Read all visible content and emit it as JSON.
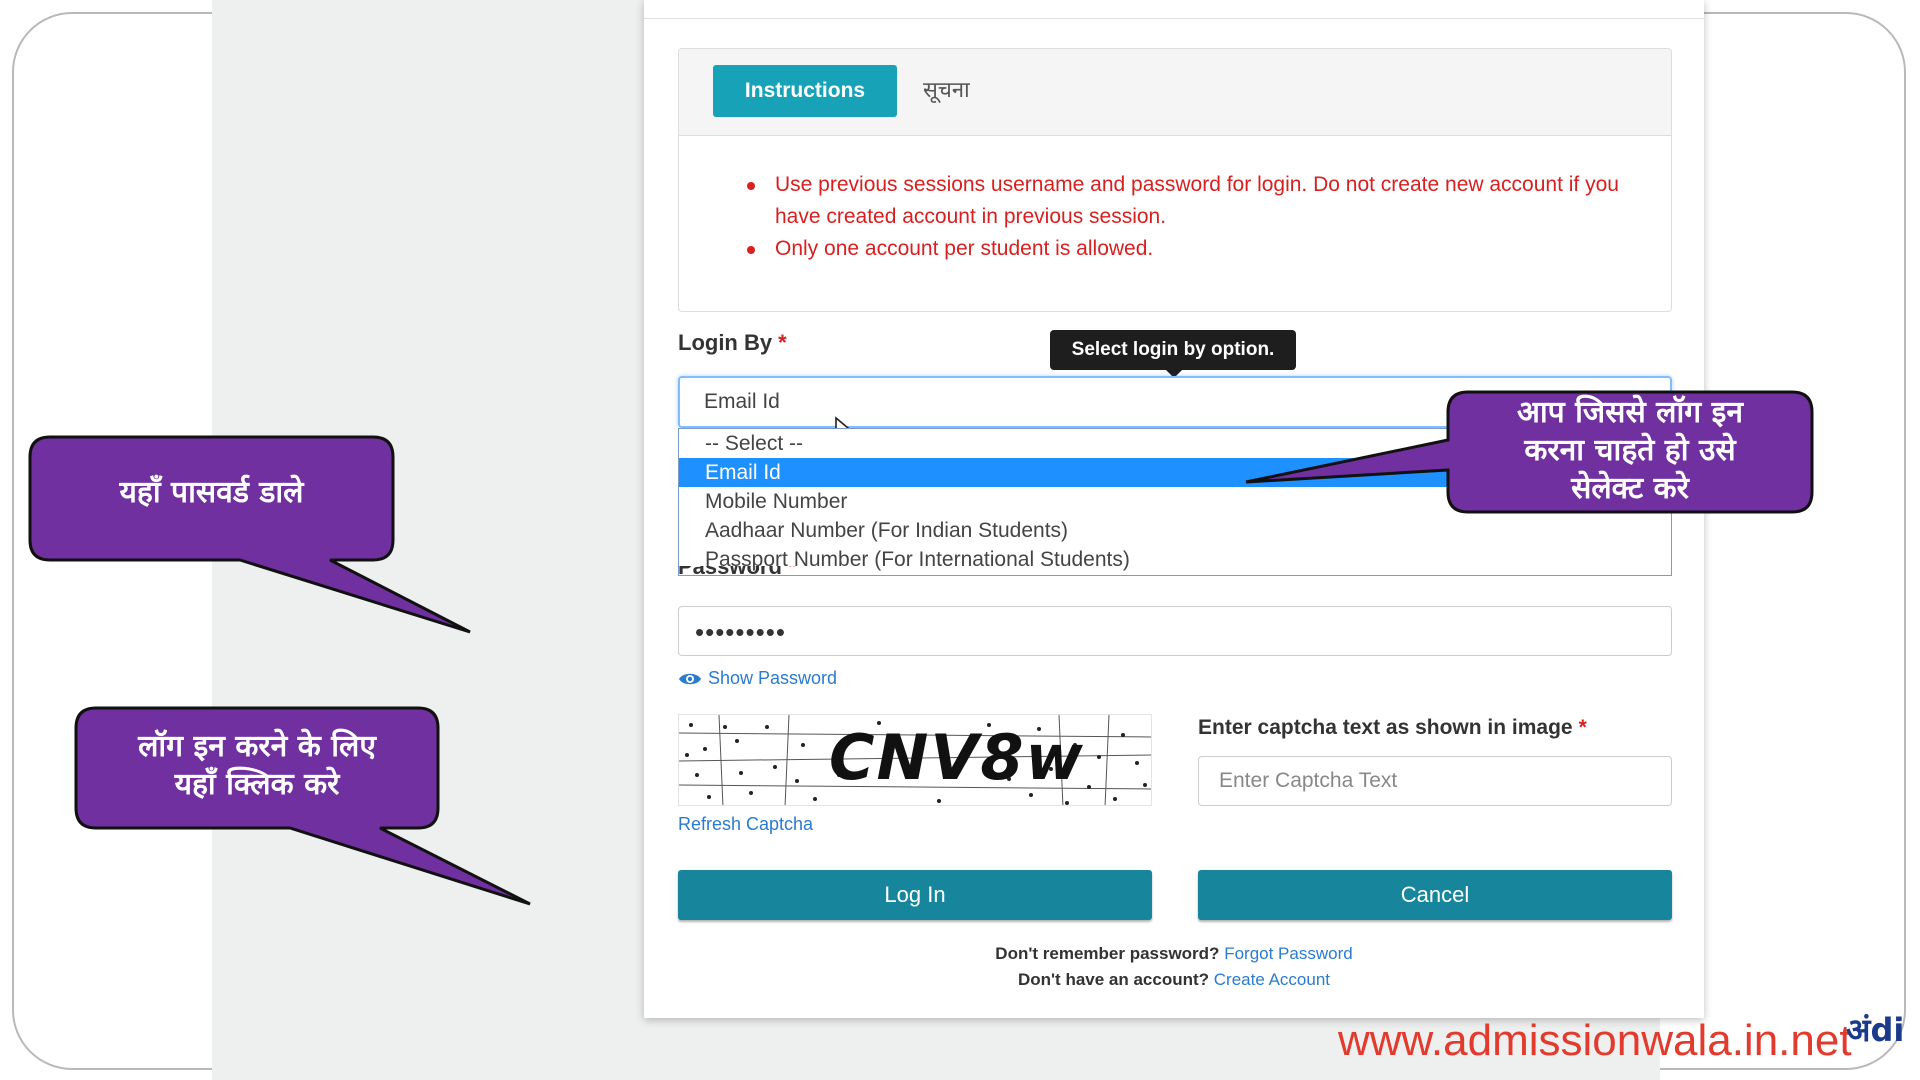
{
  "notice": {
    "tabs": [
      "Instructions",
      "सूचना"
    ],
    "items": [
      "Use previous sessions username and password for login. Do not create new account if you have created account in previous session.",
      "Only one account per student is allowed."
    ]
  },
  "login_by": {
    "label": "Login By",
    "required_mark": "*",
    "tooltip": "Select login by option.",
    "selected_value": "Email Id",
    "options": [
      "-- Select --",
      "Email Id",
      "Mobile Number",
      "Aadhaar Number (For Indian Students)",
      "Passport Number (For International Students)"
    ]
  },
  "password": {
    "label": "Password",
    "required_mark": "*",
    "masked_value": "•••••••••",
    "show_password_label": "Show Password"
  },
  "captcha": {
    "image_text": "CNV8w",
    "refresh_label": "Refresh Captcha",
    "label": "Enter captcha text as shown in image",
    "required_mark": "*",
    "placeholder": "Enter Captcha Text"
  },
  "buttons": {
    "login": "Log In",
    "cancel": "Cancel"
  },
  "footer": {
    "forgot_prompt": "Don't remember password?",
    "forgot_link": "Forgot Password",
    "account_prompt": "Don't have an account?",
    "account_link": "Create Account"
  },
  "callouts": {
    "password": "यहाँ पासवर्ड डाले",
    "login": [
      "लॉग इन करने के लिए",
      "यहाँ क्लिक करे"
    ],
    "select": [
      "आप जिससे लॉग इन",
      "करना चाहते हो उसे",
      "सेलेक्ट करे"
    ]
  },
  "branding": {
    "watermark": "www.admissionwala.in.net",
    "logo": "अंdi"
  },
  "colors": {
    "accent": "#17a2b8",
    "button": "#17869d",
    "warning_text": "#d92020",
    "callout_fill": "#7030a0",
    "selected_option": "#1e90ff"
  }
}
